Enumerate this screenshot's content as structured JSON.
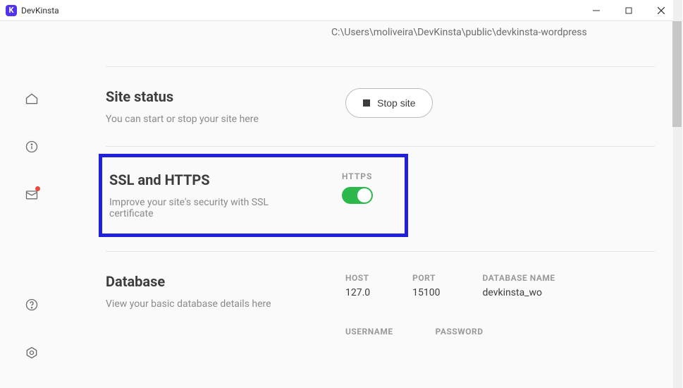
{
  "app": {
    "title": "DevKinsta"
  },
  "path": "C:\\Users\\moliveira\\DevKinsta\\public\\devkinsta-wordpress",
  "site_status": {
    "title": "Site status",
    "desc": "You can start or stop your site here",
    "button": "Stop site"
  },
  "ssl": {
    "title": "SSL and HTTPS",
    "desc": "Improve your site's security with SSL certificate",
    "toggle_label": "HTTPS"
  },
  "database": {
    "title": "Database",
    "desc": "View your basic database details here",
    "host_label": "HOST",
    "host_value": "127.0",
    "port_label": "PORT",
    "port_value": "15100",
    "name_label": "DATABASE NAME",
    "name_value": "devkinsta_wo",
    "user_label": "USERNAME",
    "pass_label": "PASSWORD"
  }
}
